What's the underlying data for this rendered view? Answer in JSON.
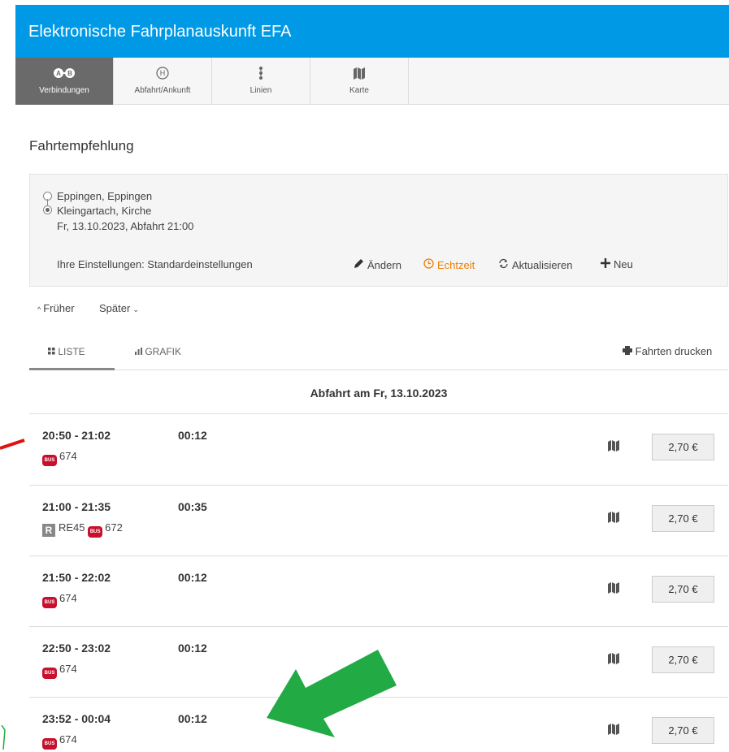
{
  "header": {
    "title": "Elektronische Fahrplanauskunft EFA"
  },
  "tabs": [
    {
      "label": "Verbindungen",
      "icon": "route-ab-icon",
      "active": true
    },
    {
      "label": "Abfahrt/Ankunft",
      "icon": "stop-h-icon",
      "active": false
    },
    {
      "label": "Linien",
      "icon": "line-dots-icon",
      "active": false
    },
    {
      "label": "Karte",
      "icon": "map-icon",
      "active": false
    }
  ],
  "section_title": "Fahrtempfehlung",
  "summary": {
    "origin": "Eppingen, Eppingen",
    "destination": "Kleingartach, Kirche",
    "datetime": "Fr, 13.10.2023, Abfahrt 21:00",
    "settings": "Ihre Einstellungen: Standardeinstellungen",
    "actions": {
      "edit": "Ändern",
      "realtime": "Echtzeit",
      "refresh": "Aktualisieren",
      "new": "Neu"
    },
    "realtime_color": "#f07d00"
  },
  "paging": {
    "earlier": "Früher",
    "later": "Später"
  },
  "view_tabs": {
    "list": "LISTE",
    "graphic": "GRAFIK",
    "print": "Fahrten drucken"
  },
  "day_heading": "Abfahrt am Fr, 13.10.2023",
  "trips": [
    {
      "times": "20:50 - 21:02",
      "duration": "00:12",
      "lines": [
        {
          "type": "bus",
          "badge": "BUS",
          "name": "674"
        }
      ],
      "price": "2,70 €"
    },
    {
      "times": "21:00 - 21:35",
      "duration": "00:35",
      "lines": [
        {
          "type": "rail",
          "badge": "R",
          "name": "RE45"
        },
        {
          "type": "bus",
          "badge": "BUS",
          "name": "672"
        }
      ],
      "price": "2,70 €"
    },
    {
      "times": "21:50 - 22:02",
      "duration": "00:12",
      "lines": [
        {
          "type": "bus",
          "badge": "BUS",
          "name": "674"
        }
      ],
      "price": "2,70 €"
    },
    {
      "times": "22:50 - 23:02",
      "duration": "00:12",
      "lines": [
        {
          "type": "bus",
          "badge": "BUS",
          "name": "674"
        }
      ],
      "price": "2,70 €"
    },
    {
      "times": "23:52 - 00:04",
      "duration": "00:12",
      "lines": [
        {
          "type": "bus",
          "badge": "BUS",
          "name": "674"
        }
      ],
      "price": "2,70 €"
    }
  ],
  "colors": {
    "header": "#0099e6",
    "bus": "#c8102e",
    "arrow_red": "#e01010",
    "arrow_green": "#22aa44"
  }
}
